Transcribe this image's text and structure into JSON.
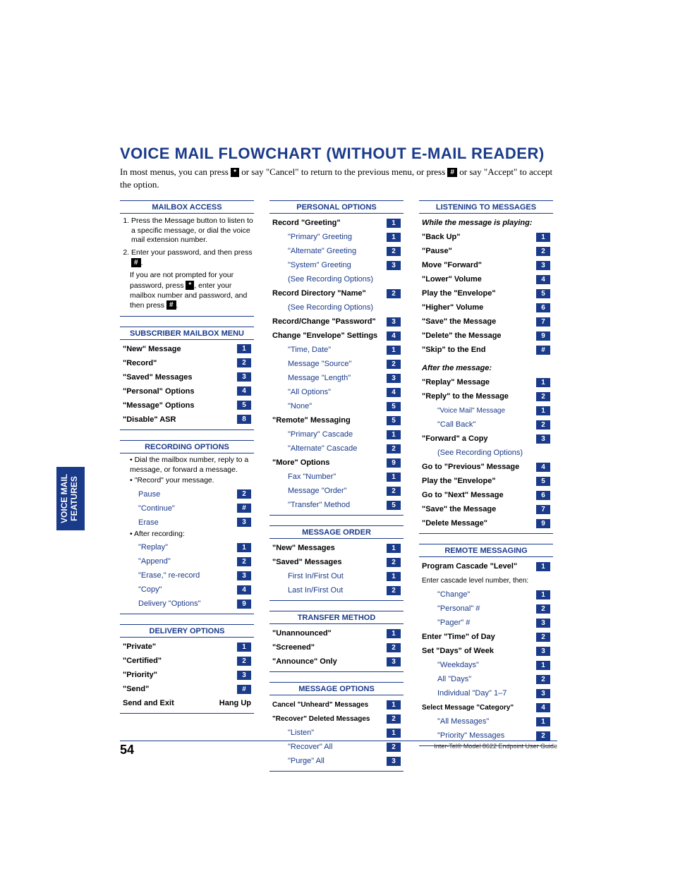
{
  "title": "VOICE MAIL FLOWCHART (WITHOUT E-MAIL READER)",
  "intro_a": "In most menus, you can press ",
  "intro_key1": "*",
  "intro_b": " or say \"Cancel\" to return to the previous menu, or press ",
  "intro_key2": "#",
  "intro_c": " or say \"Accept\" to accept the option.",
  "sidetab_l1": "VOICE MAIL",
  "sidetab_l2": "FEATURES",
  "footer_page": "54",
  "footer_text": "Inter-Tel® Model 8622 Endpoint User Guide",
  "col1": {
    "mailbox": {
      "hdr": "MAILBOX ACCESS",
      "s1": "Press the Message button to listen to a specific message, or dial the voice mail extension number.",
      "s2a": "Enter your password, and then press ",
      "s2key": "#",
      "s2b": ".",
      "s2note_a": "If you are not prompted for your password, press ",
      "s2note_key1": "*",
      "s2note_b": ", enter your mailbox number and password, and then press ",
      "s2note_key2": "#",
      "s2note_c": "."
    },
    "subscriber": {
      "hdr": "SUBSCRIBER MAILBOX MENU",
      "r": [
        {
          "l": "\"New\" Message",
          "k": "1"
        },
        {
          "l": "\"Record\"",
          "k": "2"
        },
        {
          "l": "\"Saved\" Messages",
          "k": "3"
        },
        {
          "l": "\"Personal\" Options",
          "k": "4"
        },
        {
          "l": "\"Message\" Options",
          "k": "5"
        },
        {
          "l": "\"Disable\" ASR",
          "k": "8"
        }
      ]
    },
    "recording": {
      "hdr": "RECORDING OPTIONS",
      "b1": "Dial the mailbox number, reply to a message, or forward a message.",
      "b2": "\"Record\" your message.",
      "r1": [
        {
          "l": "Pause",
          "k": "2"
        },
        {
          "l": "\"Continue\"",
          "k": "#"
        },
        {
          "l": "Erase",
          "k": "3"
        }
      ],
      "after": "After recording:",
      "r2": [
        {
          "l": "\"Replay\"",
          "k": "1"
        },
        {
          "l": "\"Append\"",
          "k": "2"
        },
        {
          "l": "\"Erase,\" re-record",
          "k": "3"
        },
        {
          "l": "\"Copy\"",
          "k": "4"
        },
        {
          "l": "Delivery \"Options\"",
          "k": "9"
        }
      ]
    },
    "delivery": {
      "hdr": "DELIVERY OPTIONS",
      "r": [
        {
          "l": "\"Private\"",
          "k": "1"
        },
        {
          "l": "\"Certified\"",
          "k": "2"
        },
        {
          "l": "\"Priority\"",
          "k": "3"
        },
        {
          "l": "\"Send\"",
          "k": "#"
        }
      ],
      "exit_l": "Send and Exit",
      "exit_r": "Hang Up"
    }
  },
  "col2": {
    "personal": {
      "hdr": "PERSONAL OPTIONS",
      "r_greeting": {
        "l": "Record \"Greeting\"",
        "k": "1"
      },
      "sub_greeting": [
        {
          "l": "\"Primary\" Greeting",
          "k": "1"
        },
        {
          "l": "\"Alternate\" Greeting",
          "k": "2"
        },
        {
          "l": "\"System\" Greeting",
          "k": "3"
        }
      ],
      "see1": "(See Recording Options)",
      "r_name": {
        "l": "Record Directory \"Name\"",
        "k": "2"
      },
      "see2": "(See Recording Options)",
      "r_pw": {
        "l": "Record/Change \"Password\"",
        "k": "3"
      },
      "r_env": {
        "l": "Change \"Envelope\" Settings",
        "k": "4"
      },
      "sub_env": [
        {
          "l": "\"Time, Date\"",
          "k": "1"
        },
        {
          "l": "Message \"Source\"",
          "k": "2"
        },
        {
          "l": "Message \"Length\"",
          "k": "3"
        },
        {
          "l": "\"All Options\"",
          "k": "4"
        },
        {
          "l": "\"None\"",
          "k": "5"
        }
      ],
      "r_remote": {
        "l": "\"Remote\" Messaging",
        "k": "5"
      },
      "sub_remote": [
        {
          "l": "\"Primary\" Cascade",
          "k": "1"
        },
        {
          "l": "\"Alternate\" Cascade",
          "k": "2"
        }
      ],
      "r_more": {
        "l": "\"More\" Options",
        "k": "9"
      },
      "sub_more": [
        {
          "l": "Fax \"Number\"",
          "k": "1"
        },
        {
          "l": "Message \"Order\"",
          "k": "2"
        },
        {
          "l": "\"Transfer\" Method",
          "k": "5"
        }
      ]
    },
    "order": {
      "hdr": "MESSAGE ORDER",
      "r": [
        {
          "l": "\"New\" Messages",
          "k": "1"
        },
        {
          "l": "\"Saved\" Messages",
          "k": "2"
        }
      ],
      "sub": [
        {
          "l": "First In/First Out",
          "k": "1"
        },
        {
          "l": "Last In/First Out",
          "k": "2"
        }
      ]
    },
    "transfer": {
      "hdr": "TRANSFER METHOD",
      "r": [
        {
          "l": "\"Unannounced\"",
          "k": "1"
        },
        {
          "l": "\"Screened\"",
          "k": "2"
        },
        {
          "l": "\"Announce\" Only",
          "k": "3"
        }
      ]
    },
    "msgopt": {
      "hdr": "MESSAGE OPTIONS",
      "r": [
        {
          "l": "Cancel \"Unheard\" Messages",
          "k": "1"
        },
        {
          "l": "\"Recover\" Deleted Messages",
          "k": "2"
        }
      ],
      "sub": [
        {
          "l": "\"Listen\"",
          "k": "1"
        },
        {
          "l": "\"Recover\" All",
          "k": "2"
        },
        {
          "l": "\"Purge\" All",
          "k": "3"
        }
      ]
    }
  },
  "col3": {
    "listening": {
      "hdr": "LISTENING TO MESSAGES",
      "while": "While the message is playing:",
      "r1": [
        {
          "l": "\"Back Up\"",
          "k": "1"
        },
        {
          "l": "\"Pause\"",
          "k": "2"
        },
        {
          "l": "Move \"Forward\"",
          "k": "3"
        },
        {
          "l": "\"Lower\" Volume",
          "k": "4"
        },
        {
          "l": "Play the \"Envelope\"",
          "k": "5"
        },
        {
          "l": "\"Higher\" Volume",
          "k": "6"
        },
        {
          "l": "\"Save\" the Message",
          "k": "7"
        },
        {
          "l": "\"Delete\" the Message",
          "k": "9"
        },
        {
          "l": "\"Skip\" to the End",
          "k": "#"
        }
      ],
      "after": "After the message:",
      "r2": [
        {
          "l": "\"Replay\" Message",
          "k": "1"
        },
        {
          "l": "\"Reply\" to the Message",
          "k": "2"
        }
      ],
      "sub_reply": [
        {
          "l": "\"Voice Mail\" Message",
          "k": "1"
        },
        {
          "l": "\"Call Back\"",
          "k": "2"
        }
      ],
      "r3": [
        {
          "l": "\"Forward\" a Copy",
          "k": "3"
        }
      ],
      "see": "(See Recording Options)",
      "r4": [
        {
          "l": "Go to \"Previous\" Message",
          "k": "4"
        },
        {
          "l": "Play the \"Envelope\"",
          "k": "5"
        },
        {
          "l": "Go to \"Next\" Message",
          "k": "6"
        },
        {
          "l": "\"Save\" the Message",
          "k": "7"
        },
        {
          "l": "\"Delete Message\"",
          "k": "9"
        }
      ]
    },
    "remote": {
      "hdr": "REMOTE MESSAGING",
      "r_level": {
        "l": "Program Cascade \"Level\"",
        "k": "1"
      },
      "note": "Enter cascade level number, then:",
      "sub_level": [
        {
          "l": "\"Change\"",
          "k": "1"
        },
        {
          "l": "\"Personal\" #",
          "k": "2"
        },
        {
          "l": "\"Pager\" #",
          "k": "3"
        }
      ],
      "r_time": {
        "l": "Enter \"Time\" of Day",
        "k": "2"
      },
      "r_days": {
        "l": "Set \"Days\" of Week",
        "k": "3"
      },
      "sub_days": [
        {
          "l": "\"Weekdays\"",
          "k": "1"
        },
        {
          "l": "All \"Days\"",
          "k": "2"
        },
        {
          "l": "Individual \"Day\" 1–7",
          "k": "3"
        }
      ],
      "r_cat": {
        "l": "Select Message \"Category\"",
        "k": "4"
      },
      "sub_cat": [
        {
          "l": "\"All Messages\"",
          "k": "1"
        },
        {
          "l": "\"Priority\" Messages",
          "k": "2"
        }
      ]
    }
  }
}
